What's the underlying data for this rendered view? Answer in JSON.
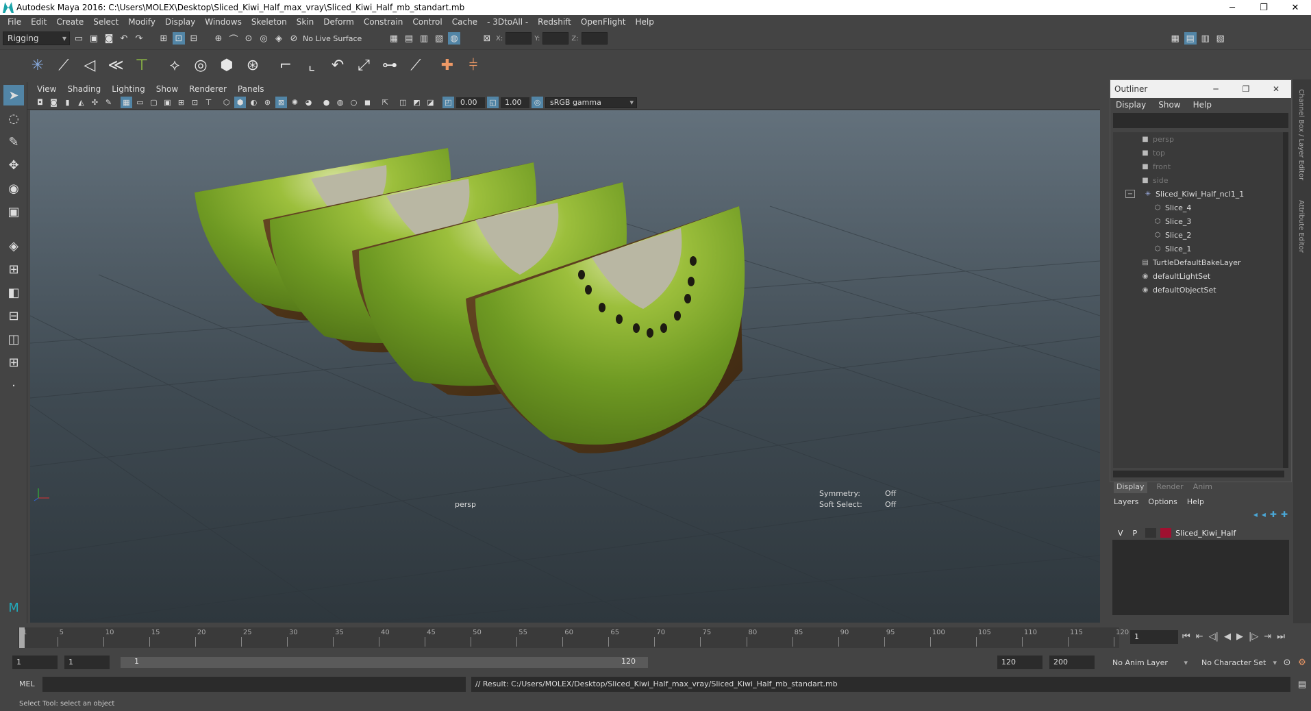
{
  "title": "Autodesk Maya 2016: C:\\Users\\MOLEX\\Desktop\\Sliced_Kiwi_Half_max_vray\\Sliced_Kiwi_Half_mb_standart.mb",
  "window_controls": {
    "minimize": "─",
    "maximize": "❐",
    "close": "✕"
  },
  "menu": [
    "File",
    "Edit",
    "Create",
    "Select",
    "Modify",
    "Display",
    "Windows",
    "Skeleton",
    "Skin",
    "Deform",
    "Constrain",
    "Control",
    "Cache",
    "- 3DtoAll -",
    "Redshift",
    "OpenFlight",
    "Help"
  ],
  "status": {
    "menuset": "Rigging",
    "live_surface": "No Live Surface",
    "x_label": "X:",
    "y_label": "Y:",
    "z_label": "Z:"
  },
  "viewport": {
    "menu": [
      "View",
      "Shading",
      "Lighting",
      "Show",
      "Renderer",
      "Panels"
    ],
    "exposure": "0.00",
    "gamma": "1.00",
    "color_space": "sRGB gamma",
    "camera_label": "persp",
    "symmetry_label": "Symmetry:",
    "symmetry_value": "Off",
    "soft_select_label": "Soft Select:",
    "soft_select_value": "Off"
  },
  "outliner": {
    "title": "Outliner",
    "menu": [
      "Display",
      "Show",
      "Help"
    ],
    "items": [
      {
        "label": "persp",
        "icon": "camera-icon",
        "dim": true,
        "indent": 2
      },
      {
        "label": "top",
        "icon": "camera-icon",
        "dim": true,
        "indent": 2
      },
      {
        "label": "front",
        "icon": "camera-icon",
        "dim": true,
        "indent": 2
      },
      {
        "label": "side",
        "icon": "camera-icon",
        "dim": true,
        "indent": 2
      },
      {
        "label": "Sliced_Kiwi_Half_ncl1_1",
        "icon": "group-icon",
        "dim": false,
        "indent": 1,
        "expanded": "−"
      },
      {
        "label": "Slice_4",
        "icon": "mesh-icon",
        "dim": false,
        "indent": 3
      },
      {
        "label": "Slice_3",
        "icon": "mesh-icon",
        "dim": false,
        "indent": 3
      },
      {
        "label": "Slice_2",
        "icon": "mesh-icon",
        "dim": false,
        "indent": 3
      },
      {
        "label": "Slice_1",
        "icon": "mesh-icon",
        "dim": false,
        "indent": 3
      },
      {
        "label": "TurtleDefaultBakeLayer",
        "icon": "layer-icon",
        "dim": false,
        "indent": 2
      },
      {
        "label": "defaultLightSet",
        "icon": "set-icon",
        "dim": false,
        "indent": 2
      },
      {
        "label": "defaultObjectSet",
        "icon": "set-icon",
        "dim": false,
        "indent": 2
      }
    ]
  },
  "side_tabs": {
    "channel_box": "Channel Box / Layer Editor",
    "attribute_editor": "Attribute Editor"
  },
  "layers": {
    "tabs": [
      "Display",
      "Render",
      "Anim"
    ],
    "menu": [
      "Layers",
      "Options",
      "Help"
    ],
    "row": {
      "v": "V",
      "p": "P",
      "name": "Sliced_Kiwi_Half",
      "color": "#a01030"
    }
  },
  "timeline": {
    "ticks": [
      "1",
      "5",
      "10",
      "15",
      "20",
      "25",
      "30",
      "35",
      "40",
      "45",
      "50",
      "55",
      "60",
      "65",
      "70",
      "75",
      "80",
      "85",
      "90",
      "95",
      "100",
      "105",
      "110",
      "115",
      "120"
    ],
    "current_frame": "1",
    "range_start": "1",
    "range_start2": "1",
    "slider_start": "1",
    "slider_end": "120",
    "end": "120",
    "anim_end": "200",
    "anim_layer": "No Anim Layer",
    "character_set": "No Character Set"
  },
  "mel": {
    "label": "MEL",
    "result": "// Result: C:/Users/MOLEX/Desktop/Sliced_Kiwi_Half_max_vray/Sliced_Kiwi_Half_mb_standart.mb"
  },
  "help_line": "Select Tool: select an object"
}
